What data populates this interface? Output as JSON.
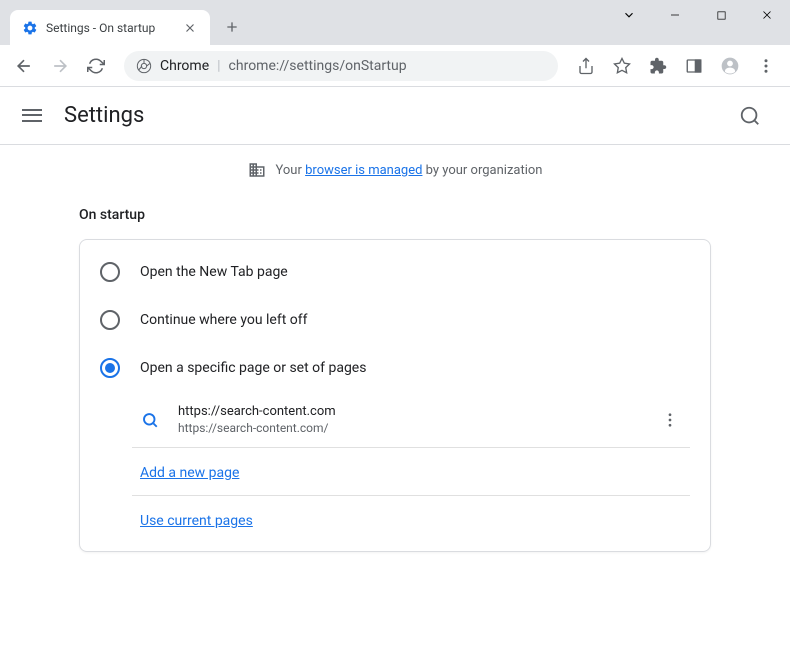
{
  "window": {
    "tab_title": "Settings - On startup"
  },
  "toolbar": {
    "address_host": "Chrome",
    "address_path": "chrome://settings/onStartup"
  },
  "settings": {
    "title": "Settings",
    "managed_prefix": "Your ",
    "managed_link": "browser is managed",
    "managed_suffix": " by your organization",
    "section_title": "On startup",
    "options": [
      {
        "label": "Open the New Tab page",
        "selected": false
      },
      {
        "label": "Continue where you left off",
        "selected": false
      },
      {
        "label": "Open a specific page or set of pages",
        "selected": true
      }
    ],
    "pages": [
      {
        "title": "https://search-content.com",
        "url": "https://search-content.com/"
      }
    ],
    "add_page_label": "Add a new page",
    "use_current_label": "Use current pages"
  }
}
